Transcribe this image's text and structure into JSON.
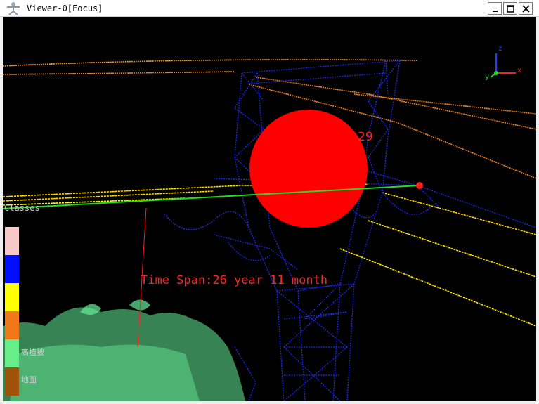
{
  "window": {
    "title": "Viewer-0[Focus]",
    "minimize_icon": "minimize-icon",
    "maximize_icon": "maximize-icon",
    "close_icon": "close-icon"
  },
  "viewport": {
    "background": "#000000",
    "circle_label": "29",
    "time_span_label": "Time Span:26 year 11 month",
    "classes_label": "Classes",
    "axis": {
      "x": "x",
      "y": "y",
      "z": "z"
    },
    "colors": {
      "marker": "#ff0000",
      "measure_line": "#22dd22",
      "tower": "#1020ff",
      "vegetation": "#66ee99",
      "wire_upper": "#ff8800",
      "wire_lower": "#ffee00"
    }
  },
  "legend": {
    "classes": [
      {
        "color": "#f8c8c8",
        "label": ""
      },
      {
        "color": "#0010ff",
        "label": ""
      },
      {
        "color": "#ffff00",
        "label": ""
      },
      {
        "color": "#f07818",
        "label": ""
      },
      {
        "color": "#66ee88",
        "label": "高植被"
      },
      {
        "color": "#a0520a",
        "label": "地面"
      }
    ]
  }
}
